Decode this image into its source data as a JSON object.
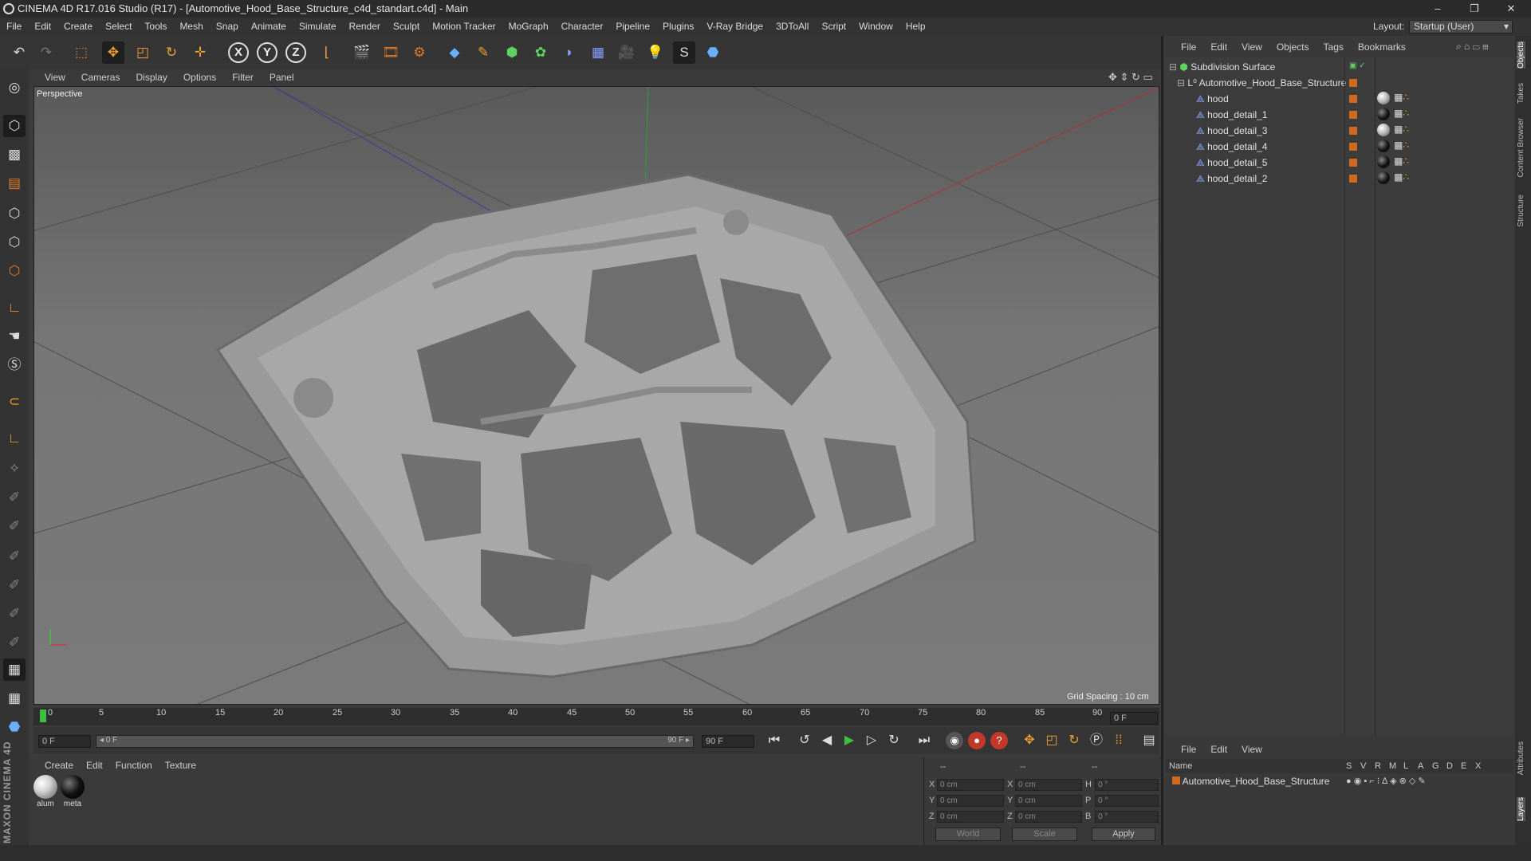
{
  "title": "CINEMA 4D R17.016 Studio (R17) - [Automotive_Hood_Base_Structure_c4d_standart.c4d] - Main",
  "window_controls": {
    "minimize": "–",
    "restore": "❐",
    "close": "✕"
  },
  "menu": [
    "File",
    "Edit",
    "Create",
    "Select",
    "Tools",
    "Mesh",
    "Snap",
    "Animate",
    "Simulate",
    "Render",
    "Sculpt",
    "Motion Tracker",
    "MoGraph",
    "Character",
    "Pipeline",
    "Plugins",
    "V-Ray Bridge",
    "3DToAll",
    "Script",
    "Window",
    "Help"
  ],
  "layout": {
    "label": "Layout:",
    "value": "Startup (User)"
  },
  "axis_buttons": [
    "X",
    "Y",
    "Z"
  ],
  "viewport": {
    "menu": [
      "View",
      "Cameras",
      "Display",
      "Options",
      "Filter",
      "Panel"
    ],
    "camera_label": "Perspective",
    "grid_spacing": "Grid Spacing : 10 cm"
  },
  "timeline": {
    "ticks": [
      "0",
      "5",
      "10",
      "15",
      "20",
      "25",
      "30",
      "35",
      "40",
      "45",
      "50",
      "55",
      "60",
      "65",
      "70",
      "75",
      "80",
      "85",
      "90"
    ],
    "current_frame_right": "0 F",
    "start_field": "0 F",
    "scrub_left": "◂ 0 F",
    "scrub_right": "90 F ▸",
    "end_field": "90 F"
  },
  "materials": {
    "menu": [
      "Create",
      "Edit",
      "Function",
      "Texture"
    ],
    "items": [
      {
        "name": "alum",
        "color": "#cfcfcf"
      },
      {
        "name": "meta",
        "color": "#111111"
      }
    ]
  },
  "coords": {
    "header": [
      "--",
      "--",
      "--"
    ],
    "rows": [
      {
        "a": "X",
        "av": "0 cm",
        "b": "X",
        "bv": "0 cm",
        "c": "H",
        "cv": "0 °"
      },
      {
        "a": "Y",
        "av": "0 cm",
        "b": "Y",
        "bv": "0 cm",
        "c": "P",
        "cv": "0 °"
      },
      {
        "a": "Z",
        "av": "0 cm",
        "b": "Z",
        "bv": "0 cm",
        "c": "B",
        "cv": "0 °"
      }
    ],
    "world": "World",
    "scale": "Scale",
    "apply": "Apply"
  },
  "objects": {
    "menu": [
      "File",
      "Edit",
      "View",
      "Objects",
      "Tags",
      "Bookmarks"
    ],
    "items": [
      {
        "name": "Subdivision Surface",
        "level": 0
      },
      {
        "name": "Automotive_Hood_Base_Structure",
        "level": 1
      },
      {
        "name": "hood",
        "level": 2
      },
      {
        "name": "hood_detail_1",
        "level": 2
      },
      {
        "name": "hood_detail_3",
        "level": 2
      },
      {
        "name": "hood_detail_4",
        "level": 2
      },
      {
        "name": "hood_detail_5",
        "level": 2
      },
      {
        "name": "hood_detail_2",
        "level": 2
      }
    ]
  },
  "layers": {
    "menu": [
      "File",
      "Edit",
      "View"
    ],
    "columns": [
      "Name",
      "S",
      "V",
      "R",
      "M",
      "L",
      "A",
      "G",
      "D",
      "E",
      "X"
    ],
    "items": [
      {
        "name": "Automotive_Hood_Base_Structure"
      }
    ]
  },
  "side_tabs": [
    "Objects",
    "Takes",
    "Content Browser",
    "Structure",
    "Attributes",
    "Layers"
  ],
  "brand": "MAXON CINEMA 4D",
  "colors": {
    "accent": "#d06a1e",
    "play": "#3fbf3f"
  }
}
